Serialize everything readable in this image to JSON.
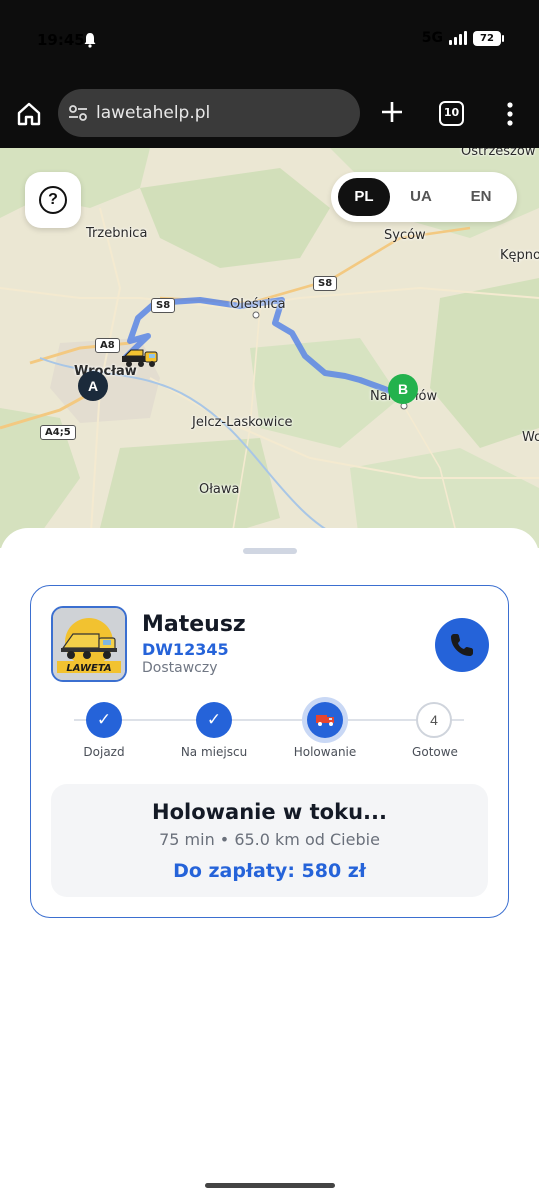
{
  "status_bar": {
    "time": "19:45",
    "network": "5G",
    "battery": "72"
  },
  "browser": {
    "url": "lawetahelp.pl",
    "tab_count": "10"
  },
  "map": {
    "help_label": "?",
    "languages": [
      {
        "label": "PL",
        "active": true
      },
      {
        "label": "UA",
        "active": false
      },
      {
        "label": "EN",
        "active": false
      }
    ],
    "places": {
      "ostrzeszow": "Ostrzeszów",
      "trzebnica": "Trzebnica",
      "sycow": "Syców",
      "kepno": "Kępno",
      "olesnica": "Oleśnica",
      "wroclaw": "Wrocław",
      "namyslow": "Namysłów",
      "jelcz": "Jelcz-Laskowice",
      "olawa": "Oława",
      "wo": "Wo"
    },
    "roads": {
      "s8": "S8",
      "s5": "S8",
      "a8": "A8",
      "a4": "A4;5"
    },
    "marker_a": "A",
    "marker_b": "B"
  },
  "driver": {
    "logo_text": "LAWETA",
    "name": "Mateusz",
    "plate": "DW12345",
    "type": "Dostawczy"
  },
  "steps": [
    {
      "label": "Dojazd",
      "state": "done",
      "symbol": "✓"
    },
    {
      "label": "Na miejscu",
      "state": "done",
      "symbol": "✓"
    },
    {
      "label": "Holowanie",
      "state": "active",
      "symbol": ""
    },
    {
      "label": "Gotowe",
      "state": "pending",
      "symbol": "4"
    }
  ],
  "status": {
    "title": "Holowanie w toku...",
    "meta": "75 min • 65.0 km od Ciebie",
    "price": "Do zapłaty: 580 zł"
  },
  "colors": {
    "accent": "#2563d9",
    "route": "#5b86e5",
    "marker_b": "#23b24d",
    "marker_a": "#1b2a3b"
  }
}
